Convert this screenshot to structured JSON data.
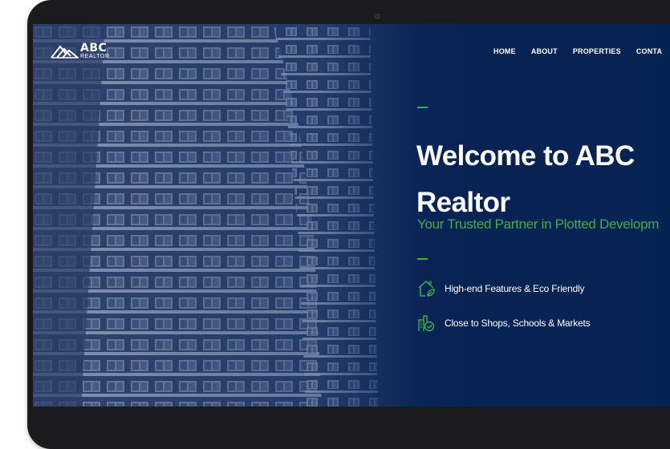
{
  "logo": {
    "brand": "ABC",
    "sub": "REALTOR"
  },
  "nav": {
    "items": [
      "HOME",
      "ABOUT",
      "PROPERTIES",
      "CONTA"
    ]
  },
  "hero": {
    "title": "Welcome to ABC Realtor",
    "tagline": "Your Trusted Partner in Plotted Developm",
    "accent_color": "#3fae49",
    "features": [
      {
        "icon": "eco-home-icon",
        "label": "High-end Features & Eco Friendly"
      },
      {
        "icon": "city-check-icon",
        "label": "Close to Shops, Schools & Markets"
      }
    ]
  }
}
